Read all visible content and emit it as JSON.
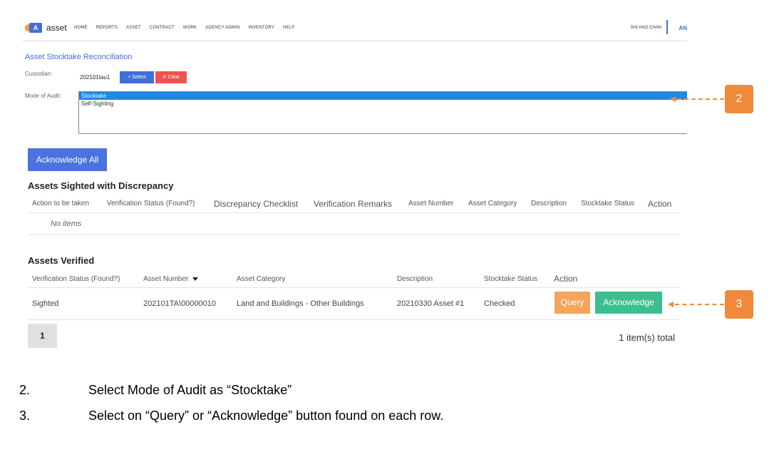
{
  "nav": {
    "logo_letter": "A",
    "logo_text": "asset",
    "items": [
      "HOME",
      "REPORTS",
      "ASSET",
      "CONTRACT",
      "WORK",
      "AGENCY ADMIN",
      "INVENTORY",
      "HELP"
    ],
    "user_name": "SHI HAO CHAN",
    "user_initials": "AN"
  },
  "page": {
    "title": "Asset Stocktake Reconciliation",
    "custodian_label": "Custodian:",
    "custodian_value": "202101tau1",
    "select_label": "+ Select",
    "clear_label": "✕ Clear",
    "mode_label": "Mode of Audit:",
    "mode_options": [
      "Stocktake",
      "Self-Sighting"
    ],
    "acknowledge_all_label": "Acknowledge All"
  },
  "discrepancy": {
    "title": "Assets Sighted with Discrepancy",
    "columns": [
      "Action to be taken",
      "Verification Status (Found?)",
      "Discrepancy Checklist",
      "Verification Remarks",
      "Asset Number",
      "Asset Category",
      "Description",
      "Stocktake Status",
      "Action"
    ],
    "empty_text": "No items"
  },
  "verified": {
    "title": "Assets Verified",
    "columns": [
      "Verification Status (Found?)",
      "Asset Number",
      "Asset Category",
      "Description",
      "Stocktake Status",
      "Action"
    ],
    "rows": [
      {
        "status": "Sighted",
        "asset_number": "202101TA\\00000010",
        "category": "Land and Buildings - Other Buildings",
        "description": "20210330 Asset #1",
        "stocktake_status": "Checked",
        "query_label": "Query",
        "acknowledge_label": "Acknowledge"
      }
    ],
    "page": "1",
    "total": "1 item(s) total"
  },
  "callouts": [
    "2",
    "3"
  ],
  "instructions": [
    {
      "num": "2.",
      "text": "Select Mode of Audit as “Stocktake”"
    },
    {
      "num": "3.",
      "text": "Select on “Query” or “Acknowledge” button found on each row."
    }
  ],
  "colors": {
    "primary": "#3f6fd8",
    "danger": "#ef5350",
    "query": "#f5a55b",
    "acknowledge": "#3cbf8f",
    "callout": "#f08a3a",
    "selected_option": "#1e88e5"
  }
}
